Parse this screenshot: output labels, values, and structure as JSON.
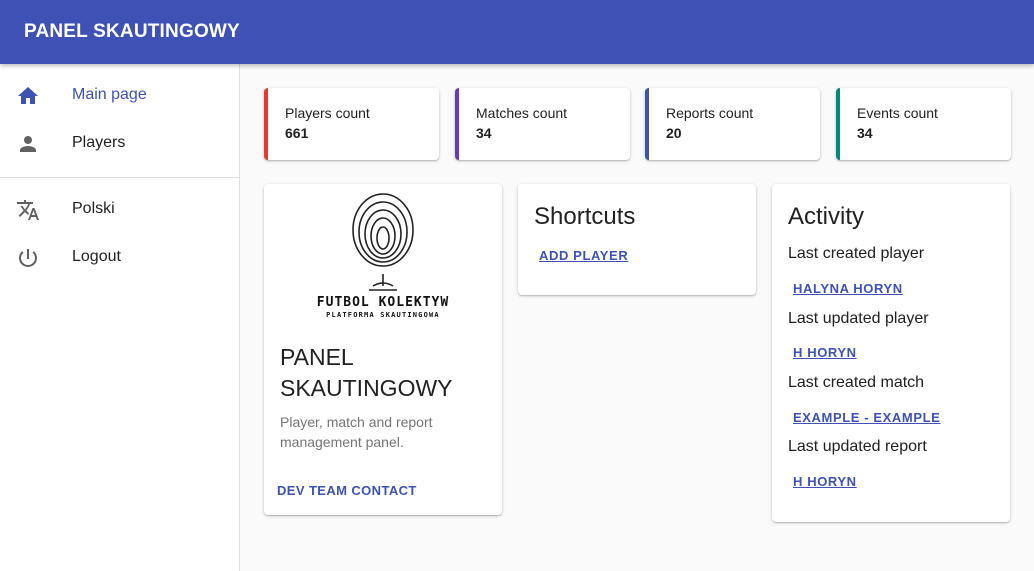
{
  "app": {
    "title": "PANEL SKAUTINGOWY"
  },
  "sidebar": {
    "items": [
      {
        "label": "Main page",
        "icon": "home-icon",
        "active": true
      },
      {
        "label": "Players",
        "icon": "person-icon",
        "active": false
      },
      {
        "label": "Polski",
        "icon": "translate-icon",
        "active": false
      },
      {
        "label": "Logout",
        "icon": "power-icon",
        "active": false
      }
    ]
  },
  "stats": [
    {
      "title": "Players count",
      "value": "661",
      "color": "#e53935"
    },
    {
      "title": "Matches count",
      "value": "34",
      "color": "#673ab7"
    },
    {
      "title": "Reports count",
      "value": "20",
      "color": "#3f51b5"
    },
    {
      "title": "Events count",
      "value": "34",
      "color": "#00897b"
    }
  ],
  "panel_card": {
    "logo_text": "FUTBOL KOLEKTYW",
    "logo_subtext": "PLATFORMA SKAUTINGOWA",
    "title": "PANEL SKAUTINGOWY",
    "description": "Player, match and report management panel.",
    "dev_contact": "DEV TEAM CONTACT"
  },
  "shortcuts": {
    "title": "Shortcuts",
    "add_player": "ADD PLAYER"
  },
  "activity": {
    "title": "Activity",
    "items": [
      {
        "label": "Last created player",
        "link": "HALYNA HORYN"
      },
      {
        "label": "Last updated player",
        "link": "H HORYN"
      },
      {
        "label": "Last created match",
        "link": "EXAMPLE - EXAMPLE"
      },
      {
        "label": "Last updated report",
        "link": "H HORYN"
      }
    ]
  },
  "colors": {
    "primary": "#3f51b5"
  }
}
